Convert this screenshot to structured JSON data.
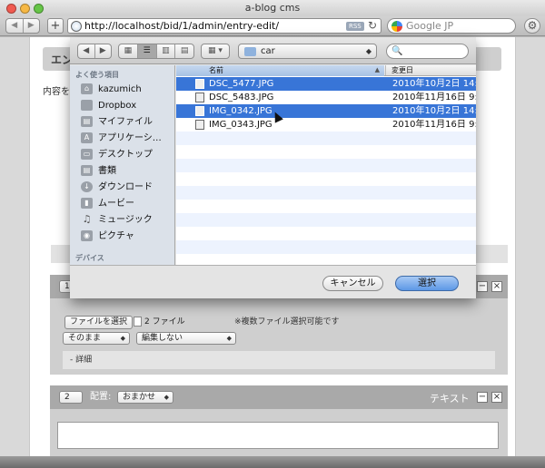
{
  "window": {
    "title": "a-blog cms"
  },
  "browser": {
    "back_icon": "◀",
    "forward_icon": "▶",
    "new_tab": "+",
    "url": "http://localhost/bid/1/admin/entry-edit/",
    "rss_badge": "RSS",
    "reload_icon": "↻",
    "search_placeholder": "Google JP",
    "settings_icon": "⚙"
  },
  "page": {
    "header_title": "エン",
    "intro_text": "内容を",
    "unit1": {
      "number": "1",
      "file_button": "ファイルを選択",
      "file_count": "2 ファイル",
      "multi_note": "※複数ファイル選択可能です",
      "size_select": "そのまま",
      "edit_select": "編集しない",
      "detail_label": "- 詳細",
      "minus": "−",
      "close": "×"
    },
    "unit2": {
      "number": "2",
      "align_label": "配置:",
      "align_select": "おまかせ",
      "title": "テキスト",
      "minus": "−",
      "close": "×"
    }
  },
  "dialog": {
    "path": "car",
    "search_icon": "🔍",
    "sidebar": {
      "favorites_heading": "よく使う項目",
      "devices_heading": "デバイス",
      "items": [
        {
          "label": "kazumich",
          "icon": "home-icon"
        },
        {
          "label": "Dropbox",
          "icon": "folder-icon"
        },
        {
          "label": "マイファイル",
          "icon": "files-icon"
        },
        {
          "label": "アプリケーシ…",
          "icon": "applications-icon"
        },
        {
          "label": "デスクトップ",
          "icon": "desktop-icon"
        },
        {
          "label": "書類",
          "icon": "documents-icon"
        },
        {
          "label": "ダウンロード",
          "icon": "downloads-icon"
        },
        {
          "label": "ムービー",
          "icon": "movies-icon"
        },
        {
          "label": "ミュージック",
          "icon": "music-icon"
        },
        {
          "label": "ピクチャ",
          "icon": "pictures-icon"
        }
      ]
    },
    "columns": {
      "name": "名前",
      "date": "変更日"
    },
    "files": [
      {
        "name": "DSC_5477.JPG",
        "date": "2010年10月2日 14:2",
        "selected": true
      },
      {
        "name": "DSC_5483.JPG",
        "date": "2010年11月16日 9:5",
        "selected": false
      },
      {
        "name": "IMG_0342.JPG",
        "date": "2010年10月2日 14:2",
        "selected": true
      },
      {
        "name": "IMG_0343.JPG",
        "date": "2010年11月16日 9:5",
        "selected": false
      }
    ],
    "cancel_button": "キャンセル",
    "select_button": "選択"
  }
}
